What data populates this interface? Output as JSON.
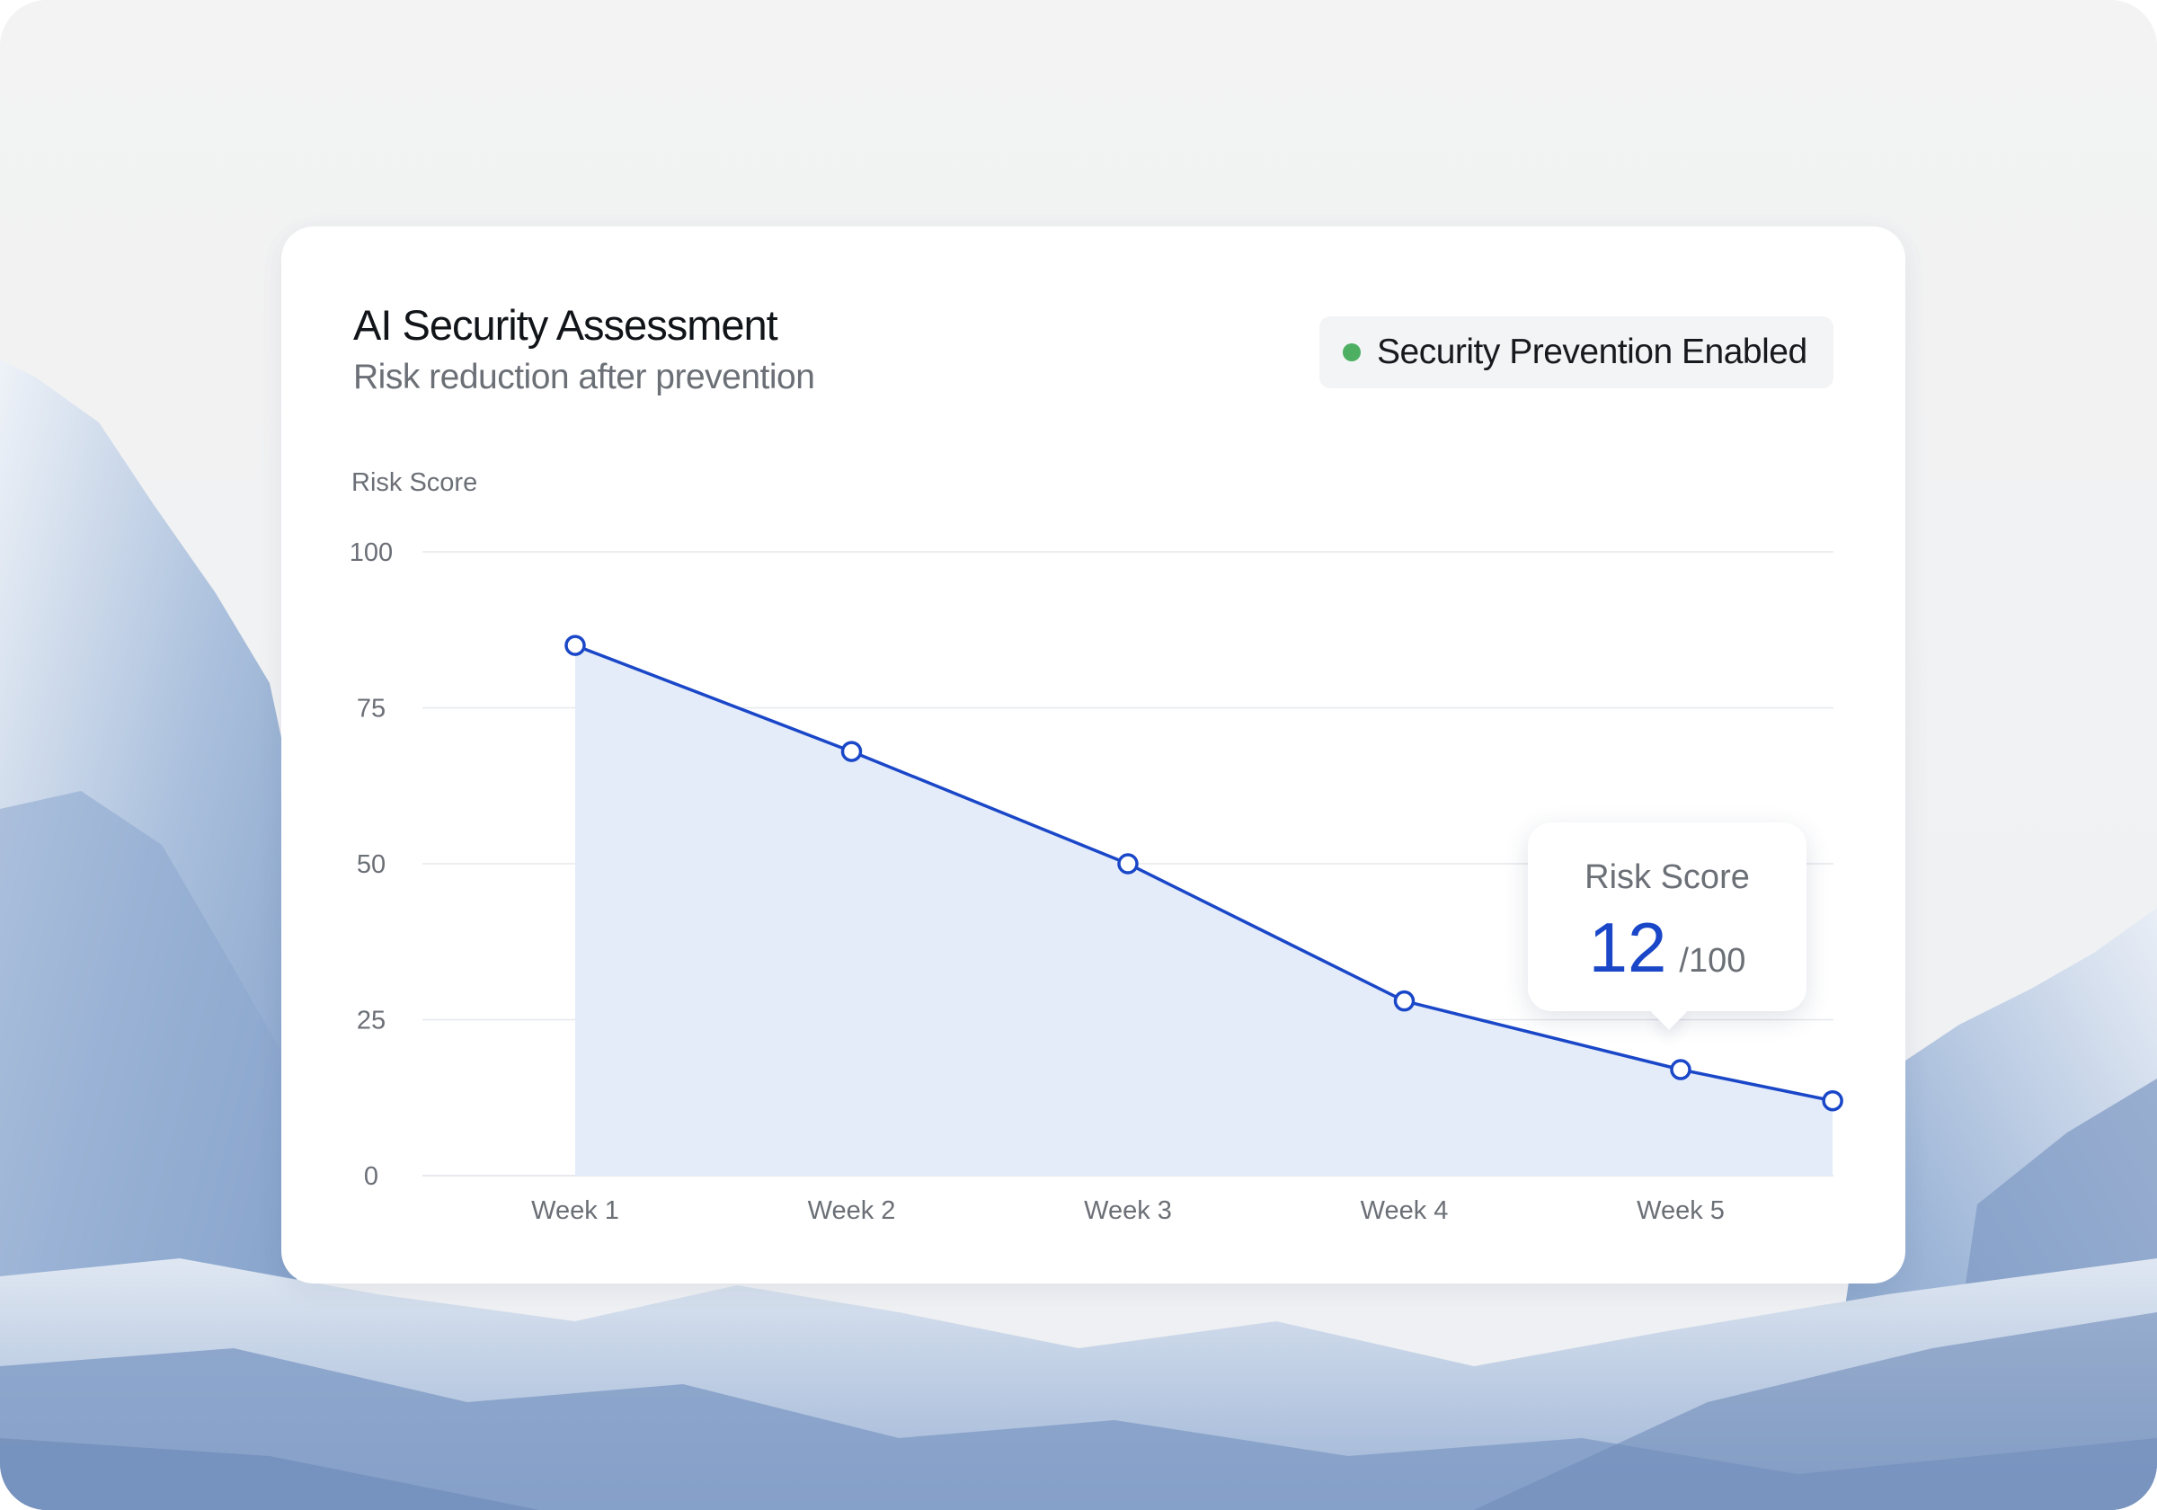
{
  "card": {
    "title": "AI Security Assessment",
    "subtitle": "Risk reduction after prevention"
  },
  "badge": {
    "label": "Security Prevention Enabled",
    "dot_color": "#4caf62"
  },
  "tooltip": {
    "label": "Risk Score",
    "value": "12",
    "max": "/100"
  },
  "colors": {
    "line": "#1a47c8",
    "area": "#e4ecf9",
    "grid": "#e6e8ec",
    "tick_text": "#6b6f76"
  },
  "chart_data": {
    "type": "area",
    "ylabel": "Risk Score",
    "ylim": [
      0,
      100
    ],
    "yticks": [
      0,
      25,
      50,
      75,
      100
    ],
    "xticks": [
      "Week 1",
      "Week 2",
      "Week 3",
      "Week 4",
      "Week 5"
    ],
    "grid": true,
    "legend": "none",
    "series": [
      {
        "x": [
          1,
          2,
          3,
          4,
          5,
          5.55
        ],
        "values": [
          85,
          68,
          50,
          28,
          17,
          12
        ]
      }
    ]
  }
}
